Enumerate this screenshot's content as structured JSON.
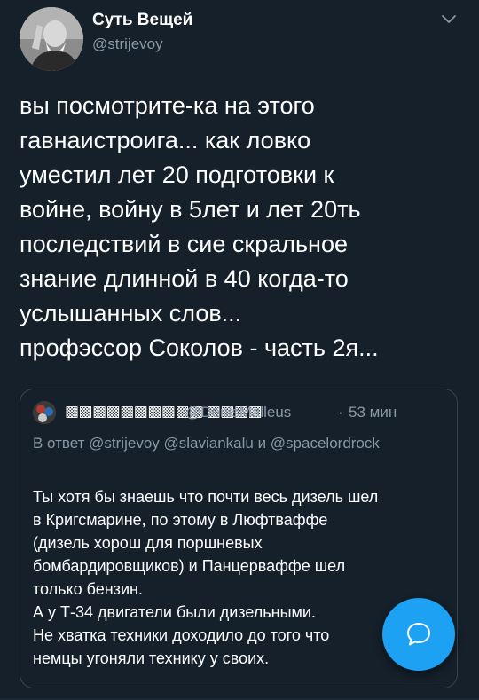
{
  "author": {
    "name": "Суть Вещей",
    "handle": "@strijevoy",
    "avatar_icon": "man-portrait-avatar"
  },
  "tweet": {
    "text": "вы посмотрите-ка на этого\nгавнаистроига... как ловко\nуместил лет 20 подготовки к\nвойне, войну в 5лет и лет 20ть\nпоследствий в сие скральное\nзнание длинной в 40 когда-то\nуслышанных слов...\nпрофэссор Соколов - часть 2я..."
  },
  "quoted": {
    "name": "▩▩▩▩▩▩▩▩▩▩ ▩▩▩▩",
    "handle": "@DenisMalleus",
    "separator": "·",
    "time": "53 мин",
    "reply_to": "В ответ @strijevoy @slaviankalu и @spacelordrock",
    "text": "Ты хотя бы знаешь что почти весь дизель шел\nв Кригсмарине, по этому в Люфтваффе\n(дизель хорош для поршневых\nбомбардировщиков) и Панцерваффе шел\nтолько бензин.\nА у Т-34 двигатели были дизельными.\nНе хватка техники доходило до того что\nнемцы угоняли технику у своих."
  },
  "compose_button": {
    "icon": "speech-bubble-icon"
  },
  "colors": {
    "background": "#15202b",
    "secondary_text": "#8899a6",
    "border": "#38444d",
    "accent": "#1da1f2"
  }
}
